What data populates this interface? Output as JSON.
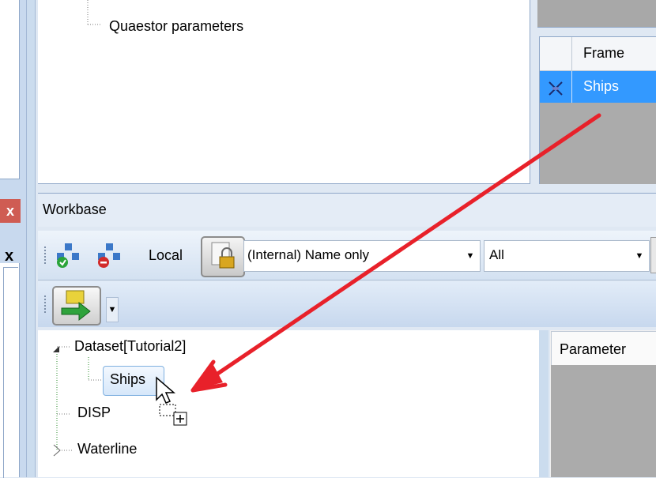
{
  "top_tree": {
    "quaestor_parameters": "Quaestor parameters"
  },
  "frame_grid": {
    "column_header": "Frame",
    "selected_row": "Ships"
  },
  "left_panel": {
    "close_glyph": "x",
    "label": "x"
  },
  "workbase": {
    "title": "Workbase",
    "toolbar": {
      "local_label": "Local",
      "name_combo_value": "(Internal) Name only",
      "filter_combo_value": "All"
    },
    "tree": {
      "dataset": "Dataset[Tutorial2]",
      "ships": "Ships",
      "disp": "DISP",
      "waterline": "Waterline"
    },
    "parameter_header": "Parameter"
  },
  "colors": {
    "selection_blue": "#3399ff",
    "annotation_arrow": "#e8212a"
  }
}
